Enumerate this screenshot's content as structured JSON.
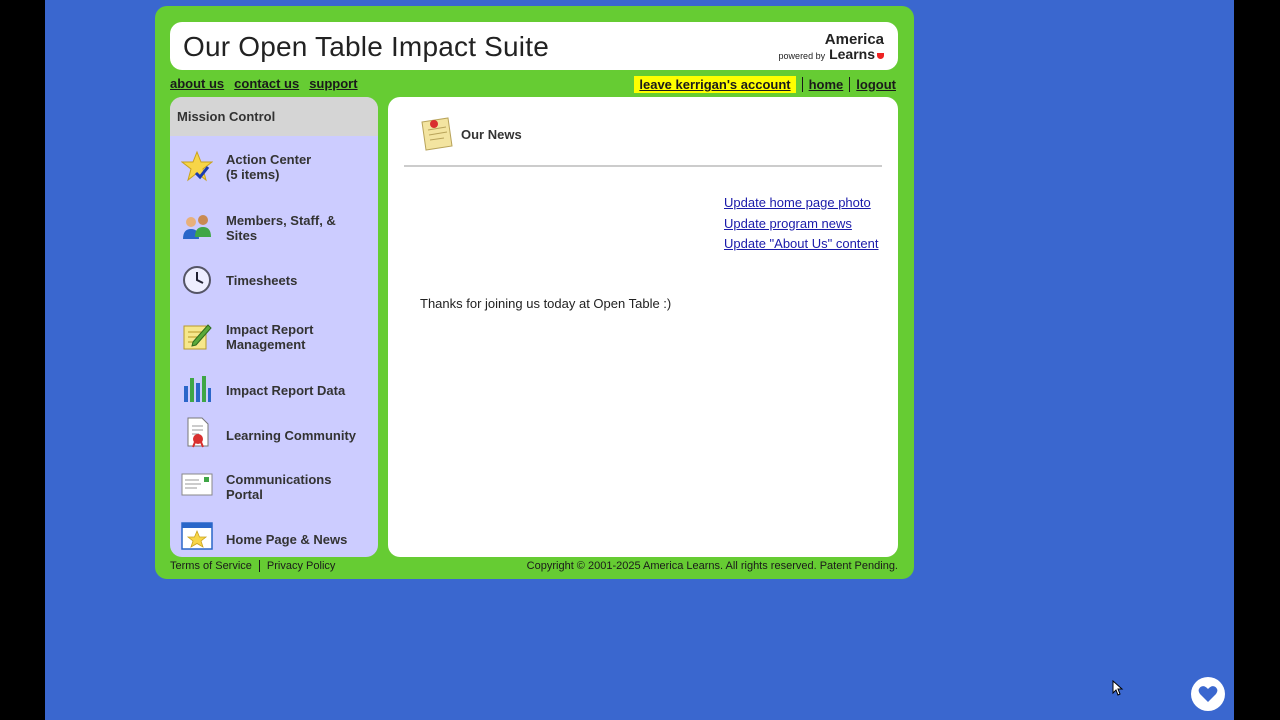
{
  "header": {
    "title": "Our Open Table Impact Suite",
    "brand_name": "America",
    "brand_powered": "powered by",
    "brand_learns": "Learns"
  },
  "topnav": {
    "about": "about us",
    "contact": "contact us",
    "support": "support",
    "leave_account": "leave kerrigan's account",
    "home": "home",
    "logout": "logout"
  },
  "sidebar": {
    "title": "Mission Control",
    "items": [
      {
        "line1": "Action Center",
        "line2": "(5 items)",
        "icon": "star-checkmark-icon"
      },
      {
        "line1": "Members, Staff, &",
        "line2": "Sites",
        "icon": "people-icon"
      },
      {
        "line1": "Timesheets",
        "line2": "",
        "icon": "clock-icon"
      },
      {
        "line1": "Impact Report",
        "line2": "Management",
        "icon": "notepad-pencil-icon"
      },
      {
        "line1": "Impact Report Data",
        "line2": "",
        "icon": "bar-chart-icon"
      },
      {
        "line1": "Learning Community",
        "line2": "",
        "icon": "document-ribbon-icon"
      },
      {
        "line1": "Communications",
        "line2": "Portal",
        "icon": "envelope-icon"
      },
      {
        "line1": "Home Page & News",
        "line2": "",
        "icon": "webpage-star-icon"
      }
    ]
  },
  "content": {
    "section_title": "Our News",
    "links": [
      "Update home page photo",
      "Update program news",
      "Update \"About Us\" content"
    ],
    "message": "Thanks for joining us today at Open Table :)"
  },
  "footer": {
    "terms": "Terms of Service",
    "privacy": "Privacy Policy",
    "copyright": "Copyright © 2001-2025 America Learns. All rights reserved. Patent Pending."
  },
  "colors": {
    "page_bg": "#3a67cf",
    "frame_green": "#66cc33",
    "sidebar_bg": "#ccccff",
    "highlight": "#ffff00",
    "link": "#1a1aaa"
  }
}
